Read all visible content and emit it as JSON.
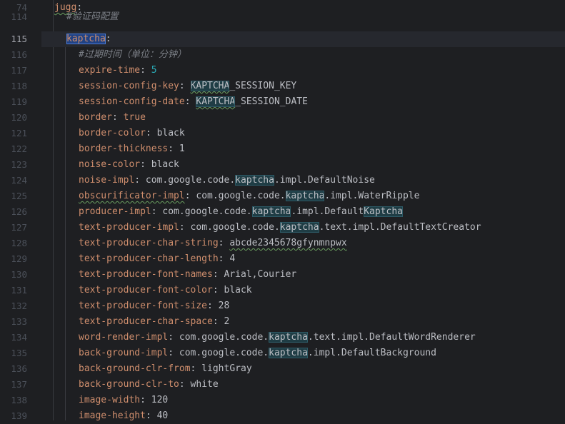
{
  "editor": {
    "lines": [
      {
        "num": "74",
        "current": false,
        "indent": 0,
        "tokens": [
          {
            "t": "jugg",
            "c": "k squig"
          },
          {
            "t": ":",
            "c": "p"
          }
        ]
      },
      {
        "num": "114",
        "current": false,
        "indent": 1,
        "tokens": [
          {
            "t": "#验证码配置",
            "c": "c"
          }
        ]
      },
      {
        "num": "115",
        "current": true,
        "indent": 1,
        "tokens": [
          {
            "t": "kaptcha",
            "c": "k hlsel"
          },
          {
            "t": ":",
            "c": "p"
          }
        ]
      },
      {
        "num": "116",
        "current": false,
        "indent": 2,
        "tokens": [
          {
            "t": "#过期时间（单位：分钟）",
            "c": "c"
          }
        ]
      },
      {
        "num": "117",
        "current": false,
        "indent": 2,
        "tokens": [
          {
            "t": "expire-time",
            "c": "k"
          },
          {
            "t": ": ",
            "c": "p"
          },
          {
            "t": "5",
            "c": "n"
          }
        ]
      },
      {
        "num": "118",
        "current": false,
        "indent": 2,
        "tokens": [
          {
            "t": "session-config-key",
            "c": "k"
          },
          {
            "t": ": ",
            "c": "p"
          },
          {
            "t": "KAPTCHA",
            "c": "p hl squig"
          },
          {
            "t": "_SESSION_KEY",
            "c": "p"
          }
        ]
      },
      {
        "num": "119",
        "current": false,
        "indent": 2,
        "tokens": [
          {
            "t": "session-config-date",
            "c": "k"
          },
          {
            "t": ": ",
            "c": "p"
          },
          {
            "t": "KAPTCHA",
            "c": "p hl squig"
          },
          {
            "t": "_SESSION_DATE",
            "c": "p"
          }
        ]
      },
      {
        "num": "120",
        "current": false,
        "indent": 2,
        "tokens": [
          {
            "t": "border",
            "c": "k"
          },
          {
            "t": ": ",
            "c": "p"
          },
          {
            "t": "true",
            "c": "k"
          }
        ]
      },
      {
        "num": "121",
        "current": false,
        "indent": 2,
        "tokens": [
          {
            "t": "border-color",
            "c": "k"
          },
          {
            "t": ": black",
            "c": "p"
          }
        ]
      },
      {
        "num": "122",
        "current": false,
        "indent": 2,
        "tokens": [
          {
            "t": "border-thickness",
            "c": "k"
          },
          {
            "t": ": ",
            "c": "p"
          },
          {
            "t": "1",
            "c": "p"
          }
        ]
      },
      {
        "num": "123",
        "current": false,
        "indent": 2,
        "tokens": [
          {
            "t": "noise-color",
            "c": "k"
          },
          {
            "t": ": black",
            "c": "p"
          }
        ]
      },
      {
        "num": "124",
        "current": false,
        "indent": 2,
        "tokens": [
          {
            "t": "noise-impl",
            "c": "k"
          },
          {
            "t": ": com.google.code.",
            "c": "p"
          },
          {
            "t": "kaptcha",
            "c": "p hl"
          },
          {
            "t": ".impl.DefaultNoise",
            "c": "p"
          }
        ]
      },
      {
        "num": "125",
        "current": false,
        "indent": 2,
        "tokens": [
          {
            "t": "obscurificator-impl",
            "c": "k squig"
          },
          {
            "t": ": com.google.code.",
            "c": "p"
          },
          {
            "t": "kaptcha",
            "c": "p hl"
          },
          {
            "t": ".impl.WaterRipple",
            "c": "p"
          }
        ]
      },
      {
        "num": "126",
        "current": false,
        "indent": 2,
        "tokens": [
          {
            "t": "producer-impl",
            "c": "k"
          },
          {
            "t": ": com.google.code.",
            "c": "p"
          },
          {
            "t": "kaptcha",
            "c": "p hl"
          },
          {
            "t": ".impl.Default",
            "c": "p"
          },
          {
            "t": "Kaptcha",
            "c": "p hl"
          }
        ]
      },
      {
        "num": "127",
        "current": false,
        "indent": 2,
        "tokens": [
          {
            "t": "text-producer-impl",
            "c": "k"
          },
          {
            "t": ": com.google.code.",
            "c": "p"
          },
          {
            "t": "kaptcha",
            "c": "p hl"
          },
          {
            "t": ".text.impl.DefaultTextCreator",
            "c": "p"
          }
        ]
      },
      {
        "num": "128",
        "current": false,
        "indent": 2,
        "tokens": [
          {
            "t": "text-producer-char-string",
            "c": "k"
          },
          {
            "t": ": ",
            "c": "p"
          },
          {
            "t": "abcde2345678gfynmnpwx",
            "c": "p squig"
          }
        ]
      },
      {
        "num": "129",
        "current": false,
        "indent": 2,
        "tokens": [
          {
            "t": "text-producer-char-length",
            "c": "k"
          },
          {
            "t": ": ",
            "c": "p"
          },
          {
            "t": "4",
            "c": "p"
          }
        ]
      },
      {
        "num": "130",
        "current": false,
        "indent": 2,
        "tokens": [
          {
            "t": "text-producer-font-names",
            "c": "k"
          },
          {
            "t": ": Arial,Courier",
            "c": "p"
          }
        ]
      },
      {
        "num": "131",
        "current": false,
        "indent": 2,
        "tokens": [
          {
            "t": "text-producer-font-color",
            "c": "k"
          },
          {
            "t": ": black",
            "c": "p"
          }
        ]
      },
      {
        "num": "132",
        "current": false,
        "indent": 2,
        "tokens": [
          {
            "t": "text-producer-font-size",
            "c": "k"
          },
          {
            "t": ": ",
            "c": "p"
          },
          {
            "t": "28",
            "c": "p"
          }
        ]
      },
      {
        "num": "133",
        "current": false,
        "indent": 2,
        "tokens": [
          {
            "t": "text-producer-char-space",
            "c": "k"
          },
          {
            "t": ": ",
            "c": "p"
          },
          {
            "t": "2",
            "c": "p"
          }
        ]
      },
      {
        "num": "134",
        "current": false,
        "indent": 2,
        "tokens": [
          {
            "t": "word-render-impl",
            "c": "k"
          },
          {
            "t": ": com.google.code.",
            "c": "p"
          },
          {
            "t": "kaptcha",
            "c": "p hl"
          },
          {
            "t": ".text.impl.DefaultWordRenderer",
            "c": "p"
          }
        ]
      },
      {
        "num": "135",
        "current": false,
        "indent": 2,
        "tokens": [
          {
            "t": "back-ground-impl",
            "c": "k"
          },
          {
            "t": ": com.google.code.",
            "c": "p"
          },
          {
            "t": "kaptcha",
            "c": "p hl"
          },
          {
            "t": ".impl.DefaultBackground",
            "c": "p"
          }
        ]
      },
      {
        "num": "136",
        "current": false,
        "indent": 2,
        "tokens": [
          {
            "t": "back-ground-clr-from",
            "c": "k"
          },
          {
            "t": ": lightGray",
            "c": "p"
          }
        ]
      },
      {
        "num": "137",
        "current": false,
        "indent": 2,
        "tokens": [
          {
            "t": "back-ground-clr-to",
            "c": "k"
          },
          {
            "t": ": white",
            "c": "p"
          }
        ]
      },
      {
        "num": "138",
        "current": false,
        "indent": 2,
        "tokens": [
          {
            "t": "image-width",
            "c": "k"
          },
          {
            "t": ": ",
            "c": "p"
          },
          {
            "t": "120",
            "c": "p"
          }
        ]
      },
      {
        "num": "139",
        "current": false,
        "indent": 2,
        "tokens": [
          {
            "t": "image-height",
            "c": "k"
          },
          {
            "t": ": ",
            "c": "p"
          },
          {
            "t": "40",
            "c": "p"
          }
        ]
      }
    ]
  },
  "colors": {
    "background": "#1e1f22",
    "key": "#cf8e6d",
    "number": "#2aacb8",
    "plain": "#bcbec4",
    "comment": "#7a7e85",
    "line_number": "#4b5059",
    "current_line": "#26282e"
  }
}
